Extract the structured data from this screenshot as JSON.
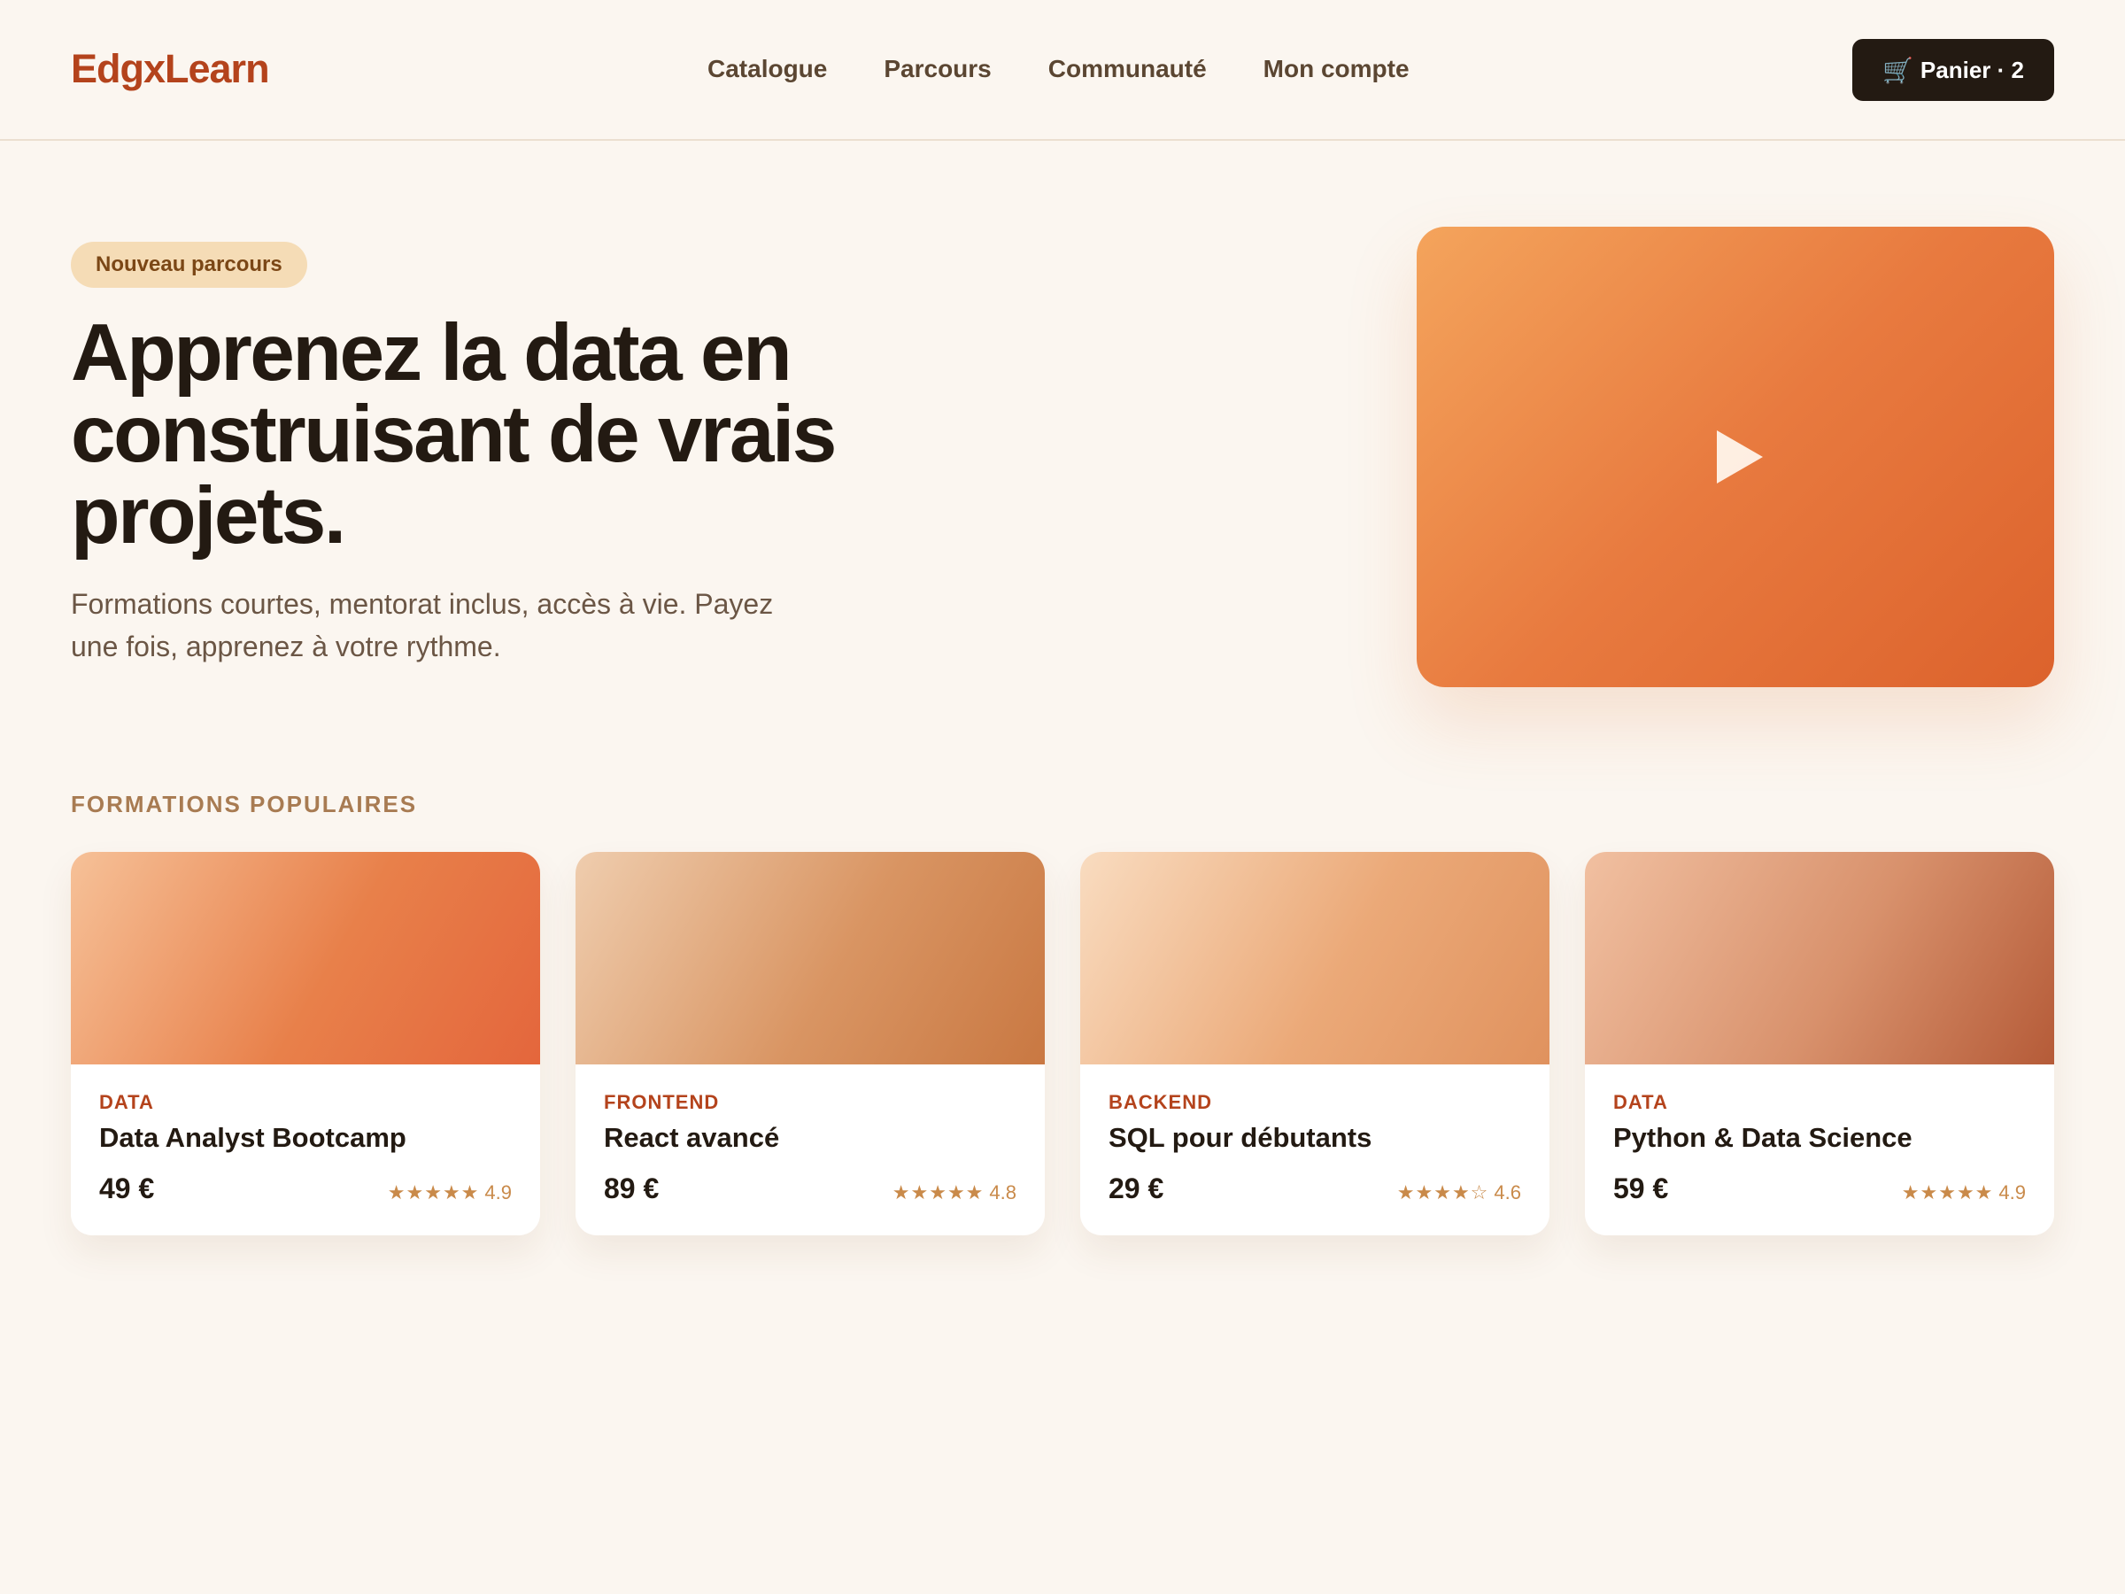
{
  "header": {
    "logo": "EdgxLearn",
    "nav": [
      "Catalogue",
      "Parcours",
      "Communauté",
      "Mon compte"
    ],
    "cart": {
      "icon": "🛒",
      "label": "Panier · 2"
    }
  },
  "hero": {
    "badge": "Nouveau parcours",
    "title": "Apprenez la data en construisant de vrais projets.",
    "subtitle": "Formations courtes, mentorat inclus, accès à vie. Payez une fois, apprenez à votre rythme.",
    "video_icon": "play-icon"
  },
  "courses_section": {
    "title": "FORMATIONS POPULAIRES",
    "courses": [
      {
        "category": "DATA",
        "title": "Data Analyst Bootcamp",
        "price": "49 €",
        "stars": "★★★★★",
        "rating": "4.9",
        "gradient": [
          "#f6c198",
          "#e8804a",
          "#e4663c"
        ]
      },
      {
        "category": "FRONTEND",
        "title": "React avancé",
        "price": "89 €",
        "stars": "★★★★★",
        "rating": "4.8",
        "gradient": [
          "#efcdae",
          "#d99563",
          "#c97842"
        ]
      },
      {
        "category": "BACKEND",
        "title": "SQL pour débutants",
        "price": "29 €",
        "stars": "★★★★☆",
        "rating": "4.6",
        "gradient": [
          "#f9dcc0",
          "#eba978",
          "#e0925e"
        ]
      },
      {
        "category": "DATA",
        "title": "Python & Data Science",
        "price": "59 €",
        "stars": "★★★★★",
        "rating": "4.9",
        "gradient": [
          "#f1c0a1",
          "#d8916c",
          "#b55b38"
        ]
      }
    ]
  },
  "colors": {
    "background": "#fbf6f0",
    "brand": "#b4431c",
    "dark": "#231a12",
    "badge_bg": "#f5dcb6",
    "rating": "#c98a4a"
  }
}
